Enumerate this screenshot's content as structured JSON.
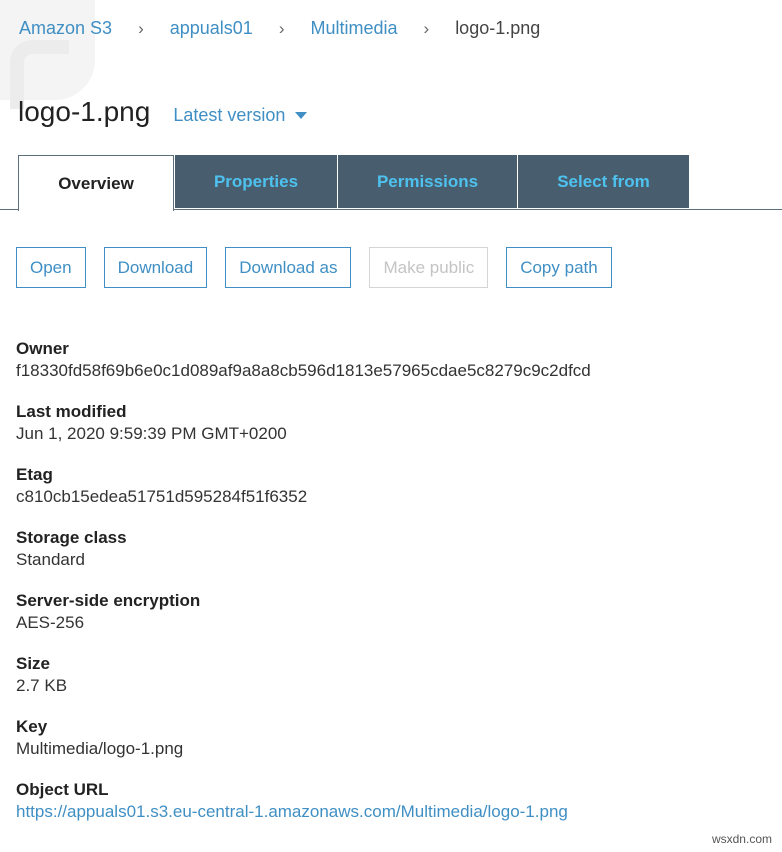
{
  "breadcrumb": {
    "items": [
      {
        "label": "Amazon S3"
      },
      {
        "label": "appuals01"
      },
      {
        "label": "Multimedia"
      }
    ],
    "current": "logo-1.png",
    "separator": "›"
  },
  "header": {
    "title": "logo-1.png",
    "version_label": "Latest version"
  },
  "tabs": {
    "overview": "Overview",
    "properties": "Properties",
    "permissions": "Permissions",
    "select_from": "Select from"
  },
  "actions": {
    "open": "Open",
    "download": "Download",
    "download_as": "Download as",
    "make_public": "Make public",
    "copy_path": "Copy path"
  },
  "details": {
    "owner": {
      "label": "Owner",
      "value": "f18330fd58f69b6e0c1d089af9a8a8cb596d1813e57965cdae5c8279c9c2dfcd"
    },
    "last_modified": {
      "label": "Last modified",
      "value": "Jun 1, 2020 9:59:39 PM GMT+0200"
    },
    "etag": {
      "label": "Etag",
      "value": "c810cb15edea51751d595284f51f6352"
    },
    "storage_class": {
      "label": "Storage class",
      "value": "Standard"
    },
    "encryption": {
      "label": "Server-side encryption",
      "value": "AES-256"
    },
    "size": {
      "label": "Size",
      "value": "2.7 KB"
    },
    "key": {
      "label": "Key",
      "value": "Multimedia/logo-1.png"
    },
    "object_url": {
      "label": "Object URL",
      "value": "https://appuals01.s3.eu-central-1.amazonaws.com/Multimedia/logo-1.png"
    }
  },
  "watermark": "wsxdn.com",
  "colors": {
    "link": "#3f8fc4",
    "tab_bg": "#485e6e",
    "tab_text": "#4ec2ef",
    "disabled": "#c4c4c4"
  }
}
